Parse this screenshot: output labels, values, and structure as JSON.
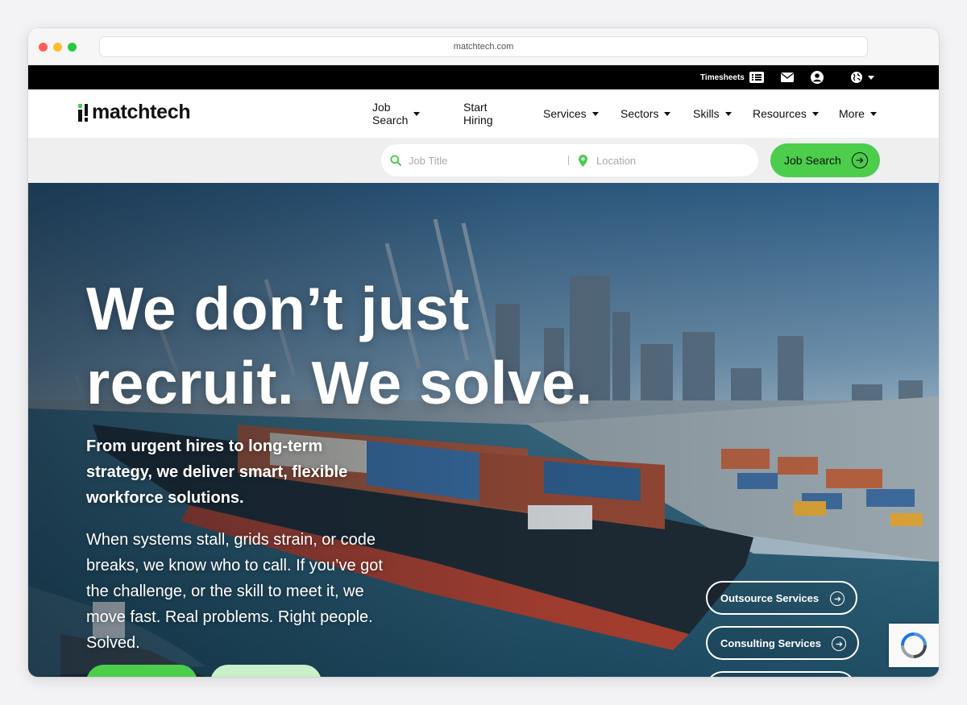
{
  "browser": {
    "url": "matchtech.com"
  },
  "topbar": {
    "timesheets_label": "Timesheets"
  },
  "brand": {
    "name": "matchtech",
    "accent": "#4ccd4c"
  },
  "nav": [
    {
      "label": "Job Search",
      "dropdown": true
    },
    {
      "label": "Start Hiring",
      "dropdown": false
    },
    {
      "label": "Services",
      "dropdown": true
    },
    {
      "label": "Sectors",
      "dropdown": true
    },
    {
      "label": "Skills",
      "dropdown": true
    },
    {
      "label": "Resources",
      "dropdown": true
    },
    {
      "label": "More",
      "dropdown": true
    }
  ],
  "search": {
    "job_placeholder": "Job Title",
    "location_placeholder": "Location",
    "button_label": "Job Search"
  },
  "hero": {
    "title_line1": "We don’t just",
    "title_line2": "recruit. We solve.",
    "subtitle": "From urgent hires to long-term strategy, we deliver smart, flexible workforce solutions.",
    "body": "When systems stall, grids strain, or code breaks, we know who to call. If you’ve got the challenge, or the skill to meet it, we move fast. Real problems. Right people. Solved.",
    "links": [
      {
        "label": "Outsource Services"
      },
      {
        "label": "Consulting Services"
      }
    ]
  }
}
